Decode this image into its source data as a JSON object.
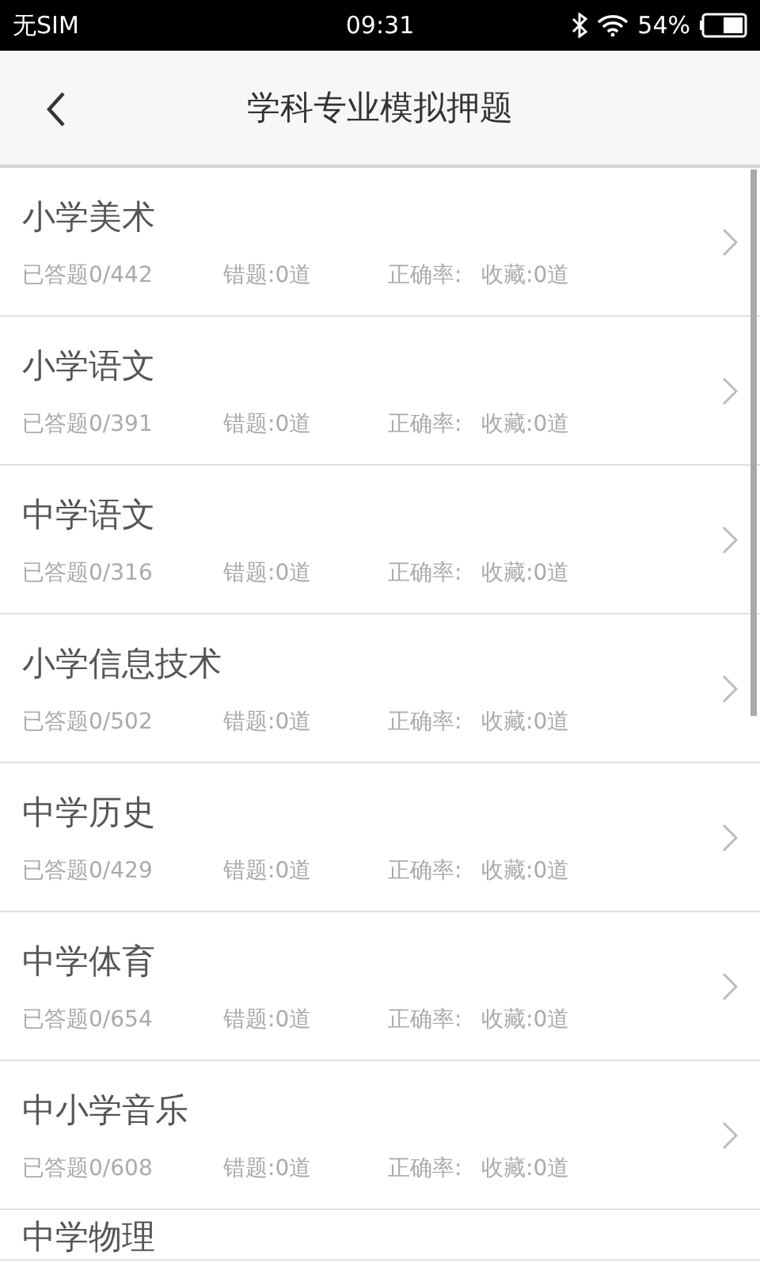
{
  "status_bar": {
    "carrier": "无SIM",
    "time": "09:31",
    "battery": "54%"
  },
  "header": {
    "title": "学科专业模拟押题"
  },
  "subjects": [
    {
      "name": "小学美术",
      "answered": "已答题0/442",
      "wrong": "错题:0道",
      "accuracy": "正确率:",
      "favorites": "收藏:0道"
    },
    {
      "name": "小学语文",
      "answered": "已答题0/391",
      "wrong": "错题:0道",
      "accuracy": "正确率:",
      "favorites": "收藏:0道"
    },
    {
      "name": "中学语文",
      "answered": "已答题0/316",
      "wrong": "错题:0道",
      "accuracy": "正确率:",
      "favorites": "收藏:0道"
    },
    {
      "name": "小学信息技术",
      "answered": "已答题0/502",
      "wrong": "错题:0道",
      "accuracy": "正确率:",
      "favorites": "收藏:0道"
    },
    {
      "name": "中学历史",
      "answered": "已答题0/429",
      "wrong": "错题:0道",
      "accuracy": "正确率:",
      "favorites": "收藏:0道"
    },
    {
      "name": "中学体育",
      "answered": "已答题0/654",
      "wrong": "错题:0道",
      "accuracy": "正确率:",
      "favorites": "收藏:0道"
    },
    {
      "name": "中小学音乐",
      "answered": "已答题0/608",
      "wrong": "错题:0道",
      "accuracy": "正确率:",
      "favorites": "收藏:0道"
    },
    {
      "name": "中学物理"
    }
  ]
}
